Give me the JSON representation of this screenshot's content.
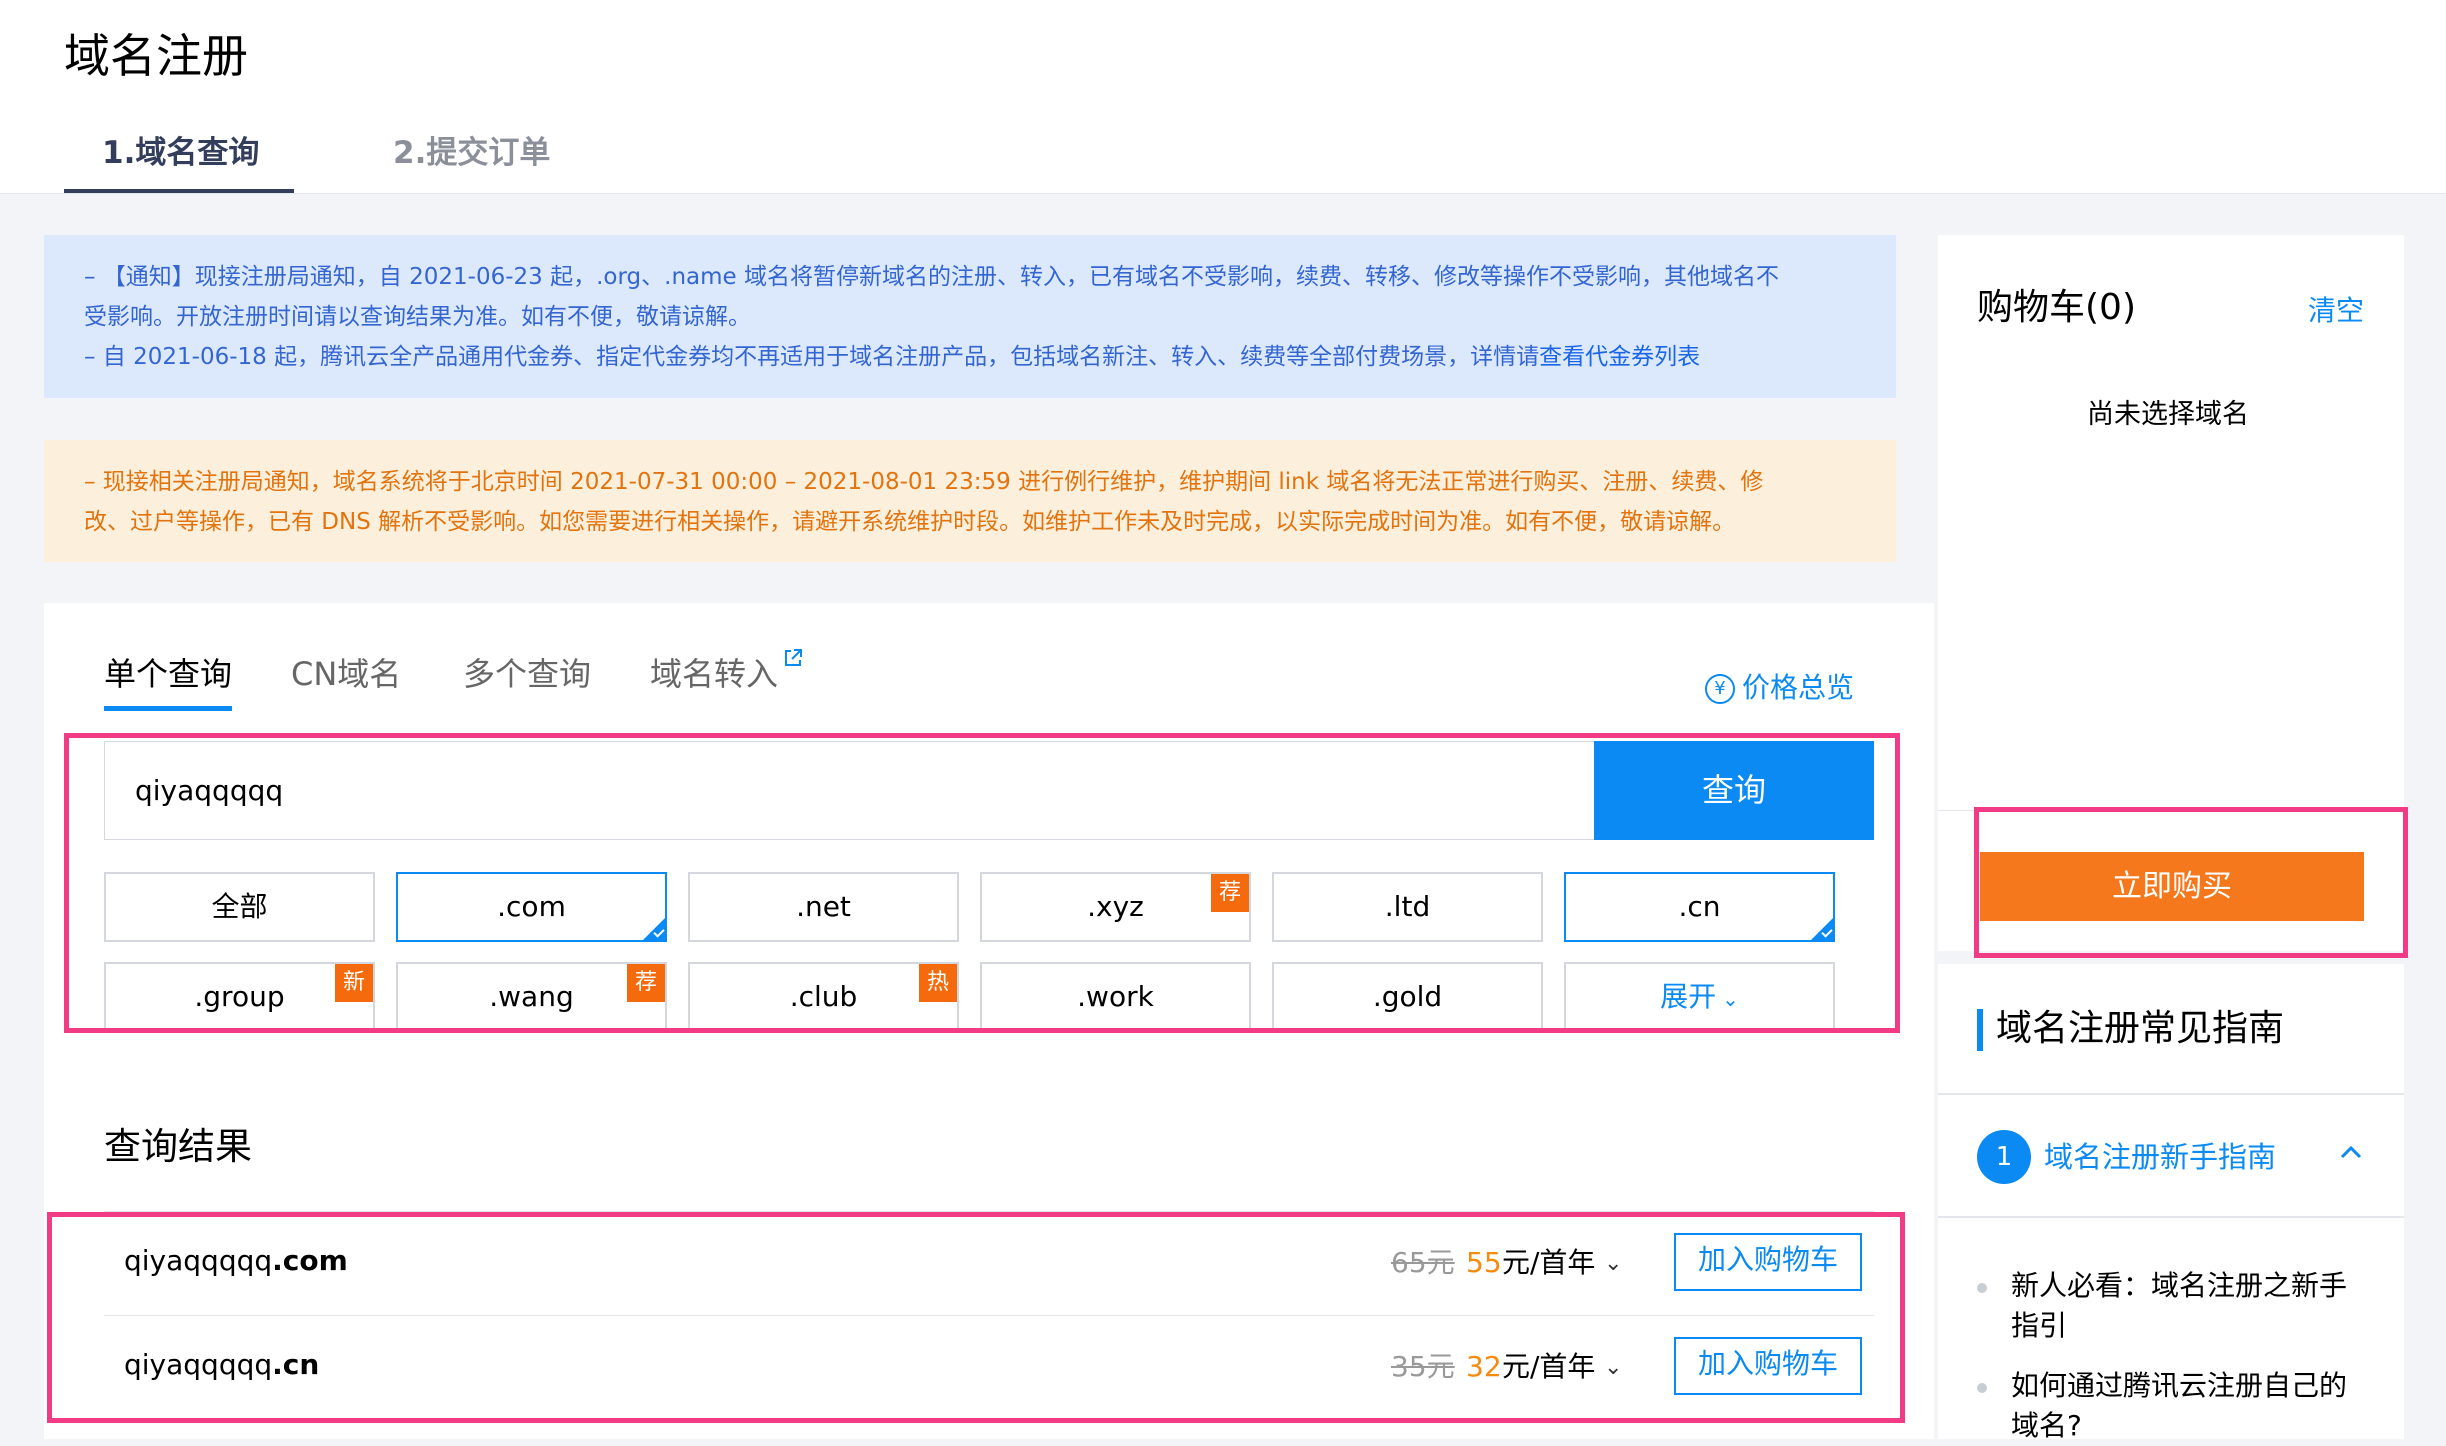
{
  "header": {
    "title": "域名注册",
    "steps": [
      "1.域名查询",
      "2.提交订单"
    ]
  },
  "notices": {
    "blue_line1": "– 【通知】现接注册局通知，自 2021-06-23 起，.org、.name 域名将暂停新域名的注册、转入，已有域名不受影响，续费、转移、修改等操作不受影响，其他域名不",
    "blue_line2": "受影响。开放注册时间请以查询结果为准。如有不便，敬请谅解。",
    "blue_line3_pre": "– 自 2021-06-18 起，腾讯云全产品通用代金券、指定代金券均不再适用于域名注册产品，包括域名新注、转入、续费等全部付费场景，详情请",
    "blue_line3_link": "查看代金券列表",
    "orange_line1": "– 现接相关注册局通知，域名系统将于北京时间 2021-07-31 00:00 – 2021-08-01 23:59 进行例行维护，维护期间 link 域名将无法正常进行购买、注册、续费、修",
    "orange_line2": "改、过户等操作，已有 DNS 解析不受影响。如您需要进行相关操作，请避开系统维护时段。如维护工作未及时完成，以实际完成时间为准。如有不便，敬请谅解。"
  },
  "query_tabs": [
    "单个查询",
    "CN域名",
    "多个查询",
    "域名转入"
  ],
  "price_overview": {
    "icon": "yuan-circle-icon",
    "label": "价格总览"
  },
  "search": {
    "value": "qiyaqqqqq",
    "button": "查询"
  },
  "tld_options": [
    {
      "label": "全部",
      "selected": false,
      "tag": ""
    },
    {
      "label": ".com",
      "selected": true,
      "tag": ""
    },
    {
      "label": ".net",
      "selected": false,
      "tag": ""
    },
    {
      "label": ".xyz",
      "selected": false,
      "tag": "荐"
    },
    {
      "label": ".ltd",
      "selected": false,
      "tag": ""
    },
    {
      "label": ".cn",
      "selected": true,
      "tag": ""
    },
    {
      "label": ".group",
      "selected": false,
      "tag": "新"
    },
    {
      "label": ".wang",
      "selected": false,
      "tag": "荐"
    },
    {
      "label": ".club",
      "selected": false,
      "tag": "热"
    },
    {
      "label": ".work",
      "selected": false,
      "tag": ""
    },
    {
      "label": ".gold",
      "selected": false,
      "tag": ""
    },
    {
      "label": "展开",
      "selected": false,
      "tag": ""
    }
  ],
  "results": {
    "title": "查询结果",
    "rows": [
      {
        "name": "qiyaqqqqq",
        "suffix": ".com",
        "old_price": "65元",
        "new_price": "55",
        "unit": "元/首年",
        "add_label": "加入购物车"
      },
      {
        "name": "qiyaqqqqq",
        "suffix": ".cn",
        "old_price": "35元",
        "new_price": "32",
        "unit": "元/首年",
        "add_label": "加入购物车"
      }
    ]
  },
  "cart": {
    "title": "购物车(0)",
    "clear": "清空",
    "empty_text": "尚未选择域名",
    "buy_label": "立即购买"
  },
  "guide": {
    "title": "域名注册常见指南",
    "item_number": "1",
    "item_title": "域名注册新手指南",
    "links": [
      "新人必看：域名注册之新手指引",
      "如何通过腾讯云注册自己的域名?"
    ]
  },
  "colors": {
    "accent": "#0a8af2",
    "buy": "#f5781c",
    "highlight": "#f23b85",
    "price_new": "#f58a0c"
  }
}
